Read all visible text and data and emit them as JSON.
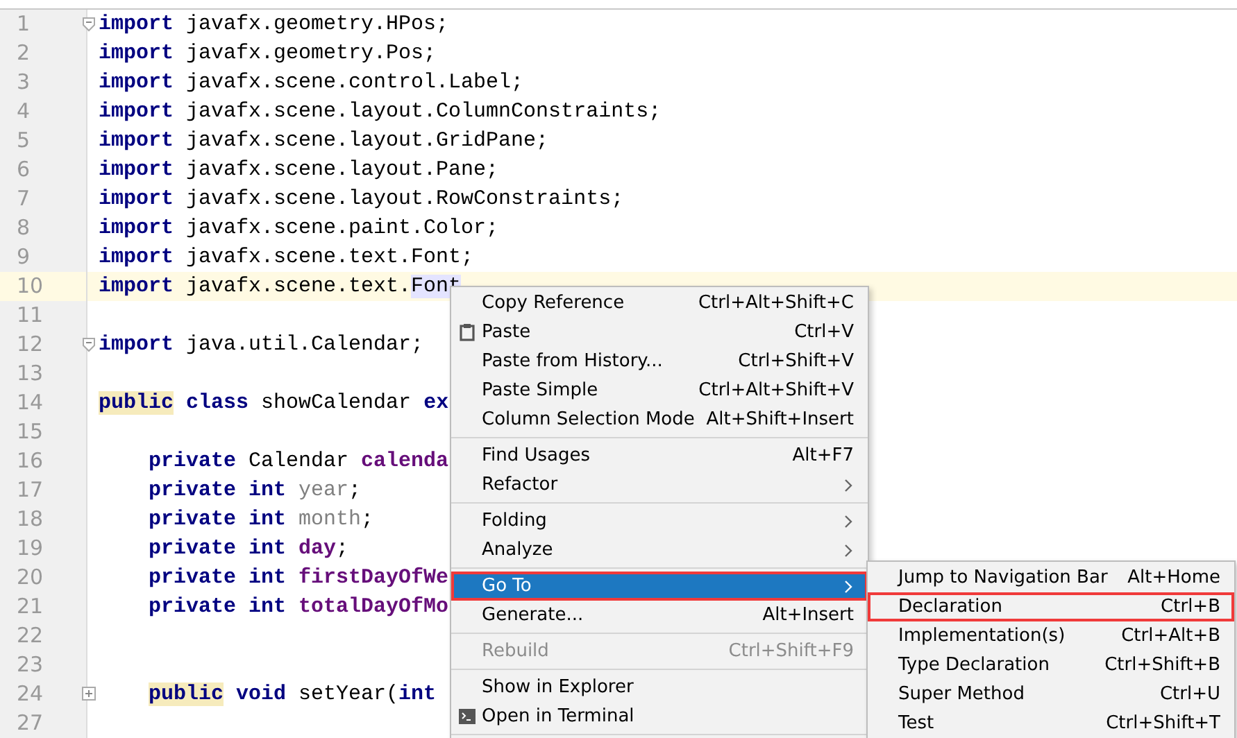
{
  "editor": {
    "lines": [
      {
        "number": "1",
        "foldable": true,
        "collapsed": false,
        "current": false,
        "indented": false,
        "tokens": [
          {
            "kind": "keyword",
            "text": "import"
          },
          {
            "kind": "plain",
            "text": " javafx.geometry.HPos;"
          }
        ]
      },
      {
        "number": "2",
        "current": false,
        "indented": false,
        "tokens": [
          {
            "kind": "keyword",
            "text": "import"
          },
          {
            "kind": "plain",
            "text": " javafx.geometry.Pos;"
          }
        ]
      },
      {
        "number": "3",
        "current": false,
        "indented": false,
        "tokens": [
          {
            "kind": "keyword",
            "text": "import"
          },
          {
            "kind": "plain",
            "text": " javafx.scene.control.Label;"
          }
        ]
      },
      {
        "number": "4",
        "current": false,
        "indented": false,
        "tokens": [
          {
            "kind": "keyword",
            "text": "import"
          },
          {
            "kind": "plain",
            "text": " javafx.scene.layout.ColumnConstraints;"
          }
        ]
      },
      {
        "number": "5",
        "current": false,
        "indented": false,
        "tokens": [
          {
            "kind": "keyword",
            "text": "import"
          },
          {
            "kind": "plain",
            "text": " javafx.scene.layout.GridPane;"
          }
        ]
      },
      {
        "number": "6",
        "current": false,
        "indented": false,
        "tokens": [
          {
            "kind": "keyword",
            "text": "import"
          },
          {
            "kind": "plain",
            "text": " javafx.scene.layout.Pane;"
          }
        ]
      },
      {
        "number": "7",
        "current": false,
        "indented": false,
        "tokens": [
          {
            "kind": "keyword",
            "text": "import"
          },
          {
            "kind": "plain",
            "text": " javafx.scene.layout.RowConstraints;"
          }
        ]
      },
      {
        "number": "8",
        "current": false,
        "indented": false,
        "tokens": [
          {
            "kind": "keyword",
            "text": "import"
          },
          {
            "kind": "plain",
            "text": " javafx.scene.paint.Color;"
          }
        ]
      },
      {
        "number": "9",
        "current": false,
        "indented": false,
        "tokens": [
          {
            "kind": "keyword",
            "text": "import"
          },
          {
            "kind": "plain",
            "text": " javafx.scene.text.Font;"
          }
        ]
      },
      {
        "number": "10",
        "current": true,
        "indented": false,
        "tokens": [
          {
            "kind": "keyword",
            "text": "import"
          },
          {
            "kind": "plain",
            "text": " javafx.scene.text."
          },
          {
            "kind": "selected",
            "text": "Font"
          }
        ]
      },
      {
        "number": "11",
        "current": false
      },
      {
        "number": "12",
        "foldable": true,
        "collapsed": false,
        "current": false,
        "indented": false,
        "tokens": [
          {
            "kind": "keyword",
            "text": "import"
          },
          {
            "kind": "plain",
            "text": " java.util.Calendar;"
          }
        ]
      },
      {
        "number": "13",
        "current": false
      },
      {
        "number": "14",
        "current": false,
        "indented": false,
        "tokens": [
          {
            "kind": "marked",
            "text": "public"
          },
          {
            "kind": "keyword",
            "text": " class"
          },
          {
            "kind": "plain",
            "text": " showCalendar "
          },
          {
            "kind": "keyword",
            "text": "ex"
          }
        ]
      },
      {
        "number": "15",
        "current": false
      },
      {
        "number": "16",
        "current": false,
        "indented": true,
        "tokens": [
          {
            "kind": "keyword",
            "text": "private"
          },
          {
            "kind": "plain",
            "text": " Calendar "
          },
          {
            "kind": "field",
            "text": "calenda"
          }
        ]
      },
      {
        "number": "17",
        "current": false,
        "indented": true,
        "tokens": [
          {
            "kind": "keyword",
            "text": "private int"
          },
          {
            "kind": "unused",
            "text": " year"
          },
          {
            "kind": "plain",
            "text": ";"
          }
        ]
      },
      {
        "number": "18",
        "current": false,
        "indented": true,
        "tokens": [
          {
            "kind": "keyword",
            "text": "private int"
          },
          {
            "kind": "unused",
            "text": " month"
          },
          {
            "kind": "plain",
            "text": ";"
          }
        ]
      },
      {
        "number": "19",
        "current": false,
        "indented": true,
        "tokens": [
          {
            "kind": "keyword",
            "text": "private int"
          },
          {
            "kind": "field",
            "text": " day"
          },
          {
            "kind": "plain",
            "text": ";"
          }
        ]
      },
      {
        "number": "20",
        "current": false,
        "indented": true,
        "tokens": [
          {
            "kind": "keyword",
            "text": "private int"
          },
          {
            "kind": "field",
            "text": " firstDayOfWe"
          }
        ]
      },
      {
        "number": "21",
        "current": false,
        "indented": true,
        "tokens": [
          {
            "kind": "keyword",
            "text": "private int"
          },
          {
            "kind": "field",
            "text": " totalDayOfMo"
          }
        ]
      },
      {
        "number": "22",
        "current": false
      },
      {
        "number": "23",
        "current": false
      },
      {
        "number": "24",
        "foldable": true,
        "collapsed": true,
        "current": false,
        "indented": true,
        "tokens": [
          {
            "kind": "marked",
            "text": "public"
          },
          {
            "kind": "keyword",
            "text": " void"
          },
          {
            "kind": "plain",
            "text": " setYear("
          },
          {
            "kind": "keyword",
            "text": "int"
          }
        ]
      },
      {
        "number": "27",
        "current": false
      }
    ]
  },
  "context_menu": {
    "items": [
      {
        "kind": "item",
        "label": "Copy Reference",
        "shortcut": "Ctrl+Alt+Shift+C",
        "selected": false,
        "disabled": false
      },
      {
        "kind": "item",
        "label": "Paste",
        "shortcut": "Ctrl+V",
        "selected": false,
        "disabled": false
      },
      {
        "kind": "item",
        "label": "Paste from History...",
        "shortcut": "Ctrl+Shift+V",
        "selected": false,
        "disabled": false
      },
      {
        "kind": "item",
        "label": "Paste Simple",
        "shortcut": "Ctrl+Alt+Shift+V",
        "selected": false,
        "disabled": false
      },
      {
        "kind": "item",
        "label": "Column Selection Mode",
        "shortcut": "Alt+Shift+Insert",
        "selected": false,
        "disabled": false
      },
      {
        "kind": "separator"
      },
      {
        "kind": "item",
        "label": "Find Usages",
        "shortcut": "Alt+F7",
        "selected": false,
        "disabled": false
      },
      {
        "kind": "submenu",
        "label": "Refactor",
        "selected": false,
        "disabled": false
      },
      {
        "kind": "separator"
      },
      {
        "kind": "submenu",
        "label": "Folding",
        "selected": false,
        "disabled": false
      },
      {
        "kind": "submenu",
        "label": "Analyze",
        "selected": false,
        "disabled": false
      },
      {
        "kind": "separator"
      },
      {
        "kind": "submenu",
        "label": "Go To",
        "selected": true,
        "highlighted_box": true,
        "disabled": false
      },
      {
        "kind": "item",
        "label": "Generate...",
        "shortcut": "Alt+Insert",
        "selected": false,
        "disabled": false
      },
      {
        "kind": "separator"
      },
      {
        "kind": "item",
        "label": "Rebuild",
        "shortcut": "Ctrl+Shift+F9",
        "selected": false,
        "disabled": true
      },
      {
        "kind": "separator"
      },
      {
        "kind": "item",
        "label": "Show in Explorer",
        "selected": false,
        "disabled": false
      },
      {
        "kind": "item",
        "label": "Open in Terminal",
        "selected": false,
        "disabled": false
      },
      {
        "kind": "separator"
      }
    ]
  },
  "submenu": {
    "items": [
      {
        "kind": "item",
        "label": "Jump to Navigation Bar",
        "shortcut": "Alt+Home",
        "selected": false,
        "disabled": false
      },
      {
        "kind": "item",
        "label": "Declaration",
        "shortcut": "Ctrl+B",
        "selected": false,
        "highlighted_box": true,
        "disabled": false
      },
      {
        "kind": "item",
        "label": "Implementation(s)",
        "shortcut": "Ctrl+Alt+B",
        "selected": false,
        "disabled": false
      },
      {
        "kind": "item",
        "label": "Type Declaration",
        "shortcut": "Ctrl+Shift+B",
        "selected": false,
        "disabled": false
      },
      {
        "kind": "item",
        "label": "Super Method",
        "shortcut": "Ctrl+U",
        "selected": false,
        "disabled": false
      },
      {
        "kind": "item",
        "label": "Test",
        "shortcut": "Ctrl+Shift+T",
        "selected": false,
        "disabled": false
      }
    ]
  }
}
